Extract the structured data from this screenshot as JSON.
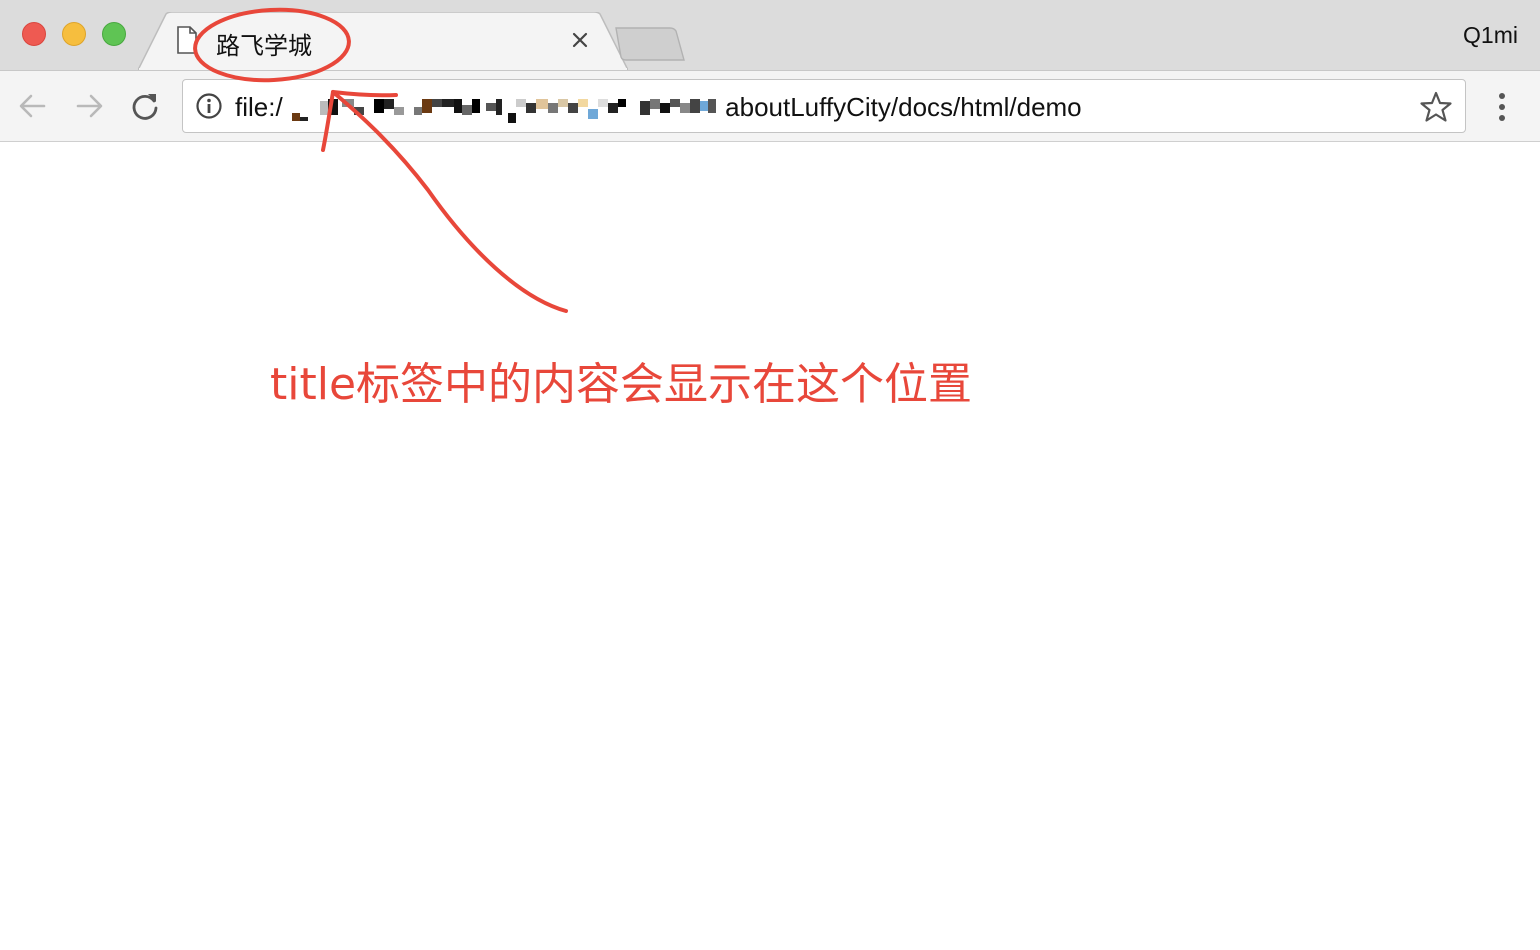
{
  "window": {
    "profile_name": "Q1mi"
  },
  "tab": {
    "title": "路飞学城",
    "favicon": "document-icon",
    "close_symbol": "×"
  },
  "toolbar": {
    "url_prefix": "file:/",
    "url_suffix": "aboutLuffyCity/docs/html/demo",
    "icons": [
      "back-arrow-icon",
      "forward-arrow-icon",
      "reload-icon",
      "info-icon",
      "star-icon",
      "menu-icon"
    ]
  },
  "annotation": {
    "text": "title标签中的内容会显示在这个位置",
    "color": "#e8473a"
  }
}
